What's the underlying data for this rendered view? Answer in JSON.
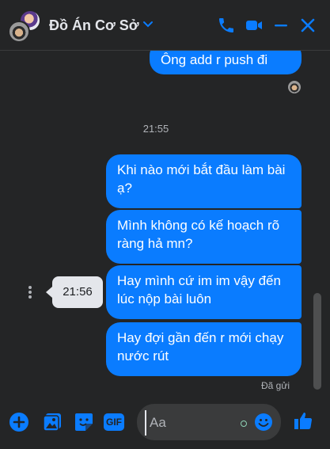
{
  "header": {
    "title": "Đồ Án Cơ Sở",
    "icons": [
      "chevron-down-icon",
      "phone-icon",
      "video-icon",
      "minimize-icon",
      "close-icon"
    ],
    "accent": "#0a7cff"
  },
  "messages": [
    {
      "text": "Ông add r push đi"
    },
    {
      "text": "Khi nào mới bắt đầu làm bài ạ?"
    },
    {
      "text": "Mình không có kế hoạch rõ ràng hả mn?"
    },
    {
      "text": "Hay mình cứ im im vậy đến lúc nộp bài luôn"
    },
    {
      "text": "Hay đợi gần đến r mới chạy nước rút"
    }
  ],
  "timestamp": "21:55",
  "tooltip": "21:56",
  "status": "Đã gửi",
  "composer": {
    "placeholder": "Aa",
    "gif_label": "GIF",
    "icons": [
      "plus-icon",
      "image-icon",
      "sticker-icon",
      "gif-icon",
      "emoji-icon",
      "like-icon"
    ]
  },
  "colors": {
    "background": "#242526",
    "bubble": "#0a7cff",
    "input": "#3a3b3c",
    "text_secondary": "#b0b3b8"
  }
}
